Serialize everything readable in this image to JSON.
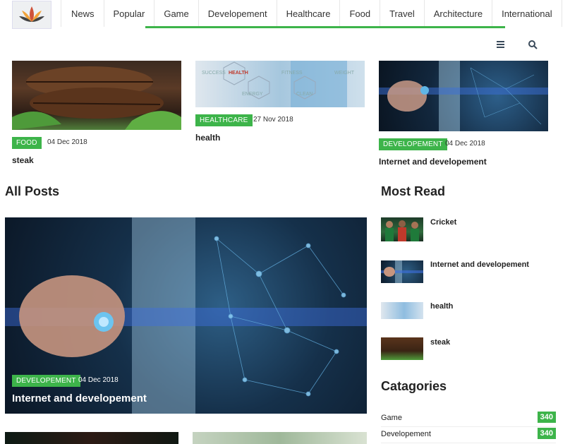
{
  "nav": {
    "items": [
      "News",
      "Popular",
      "Game",
      "Developement",
      "Healthcare",
      "Food",
      "Travel",
      "Architecture",
      "International"
    ]
  },
  "icons": {
    "menu": "hamburger-menu-icon",
    "search": "search-icon",
    "logo": "lotus-logo"
  },
  "accent_color": "#3db44a",
  "top_cards": [
    {
      "category": "FOOD",
      "date": "04 Dec 2018",
      "title": "steak"
    },
    {
      "category": "HEALTHCARE",
      "date": "27 Nov 2018",
      "title": "health",
      "image_words": [
        "SUCCESS",
        "HEALTH",
        "FITNESS",
        "WEIGHT",
        "ENERGY",
        "CLEAN"
      ]
    },
    {
      "category": "DEVELOPEMENT",
      "date": "04 Dec 2018",
      "title": "Internet and developement"
    }
  ],
  "all_posts": {
    "heading": "All Posts",
    "featured": {
      "category": "DEVELOPEMENT",
      "date": "04 Dec 2018",
      "title": "Internet and developement"
    }
  },
  "most_read": {
    "heading": "Most Read",
    "items": [
      {
        "title": "Cricket"
      },
      {
        "title": "Internet and developement"
      },
      {
        "title": "health"
      },
      {
        "title": "steak"
      }
    ]
  },
  "categories": {
    "heading": "Catagories",
    "items": [
      {
        "label": "Game",
        "count": "340"
      },
      {
        "label": "Developement",
        "count": "340"
      }
    ]
  }
}
